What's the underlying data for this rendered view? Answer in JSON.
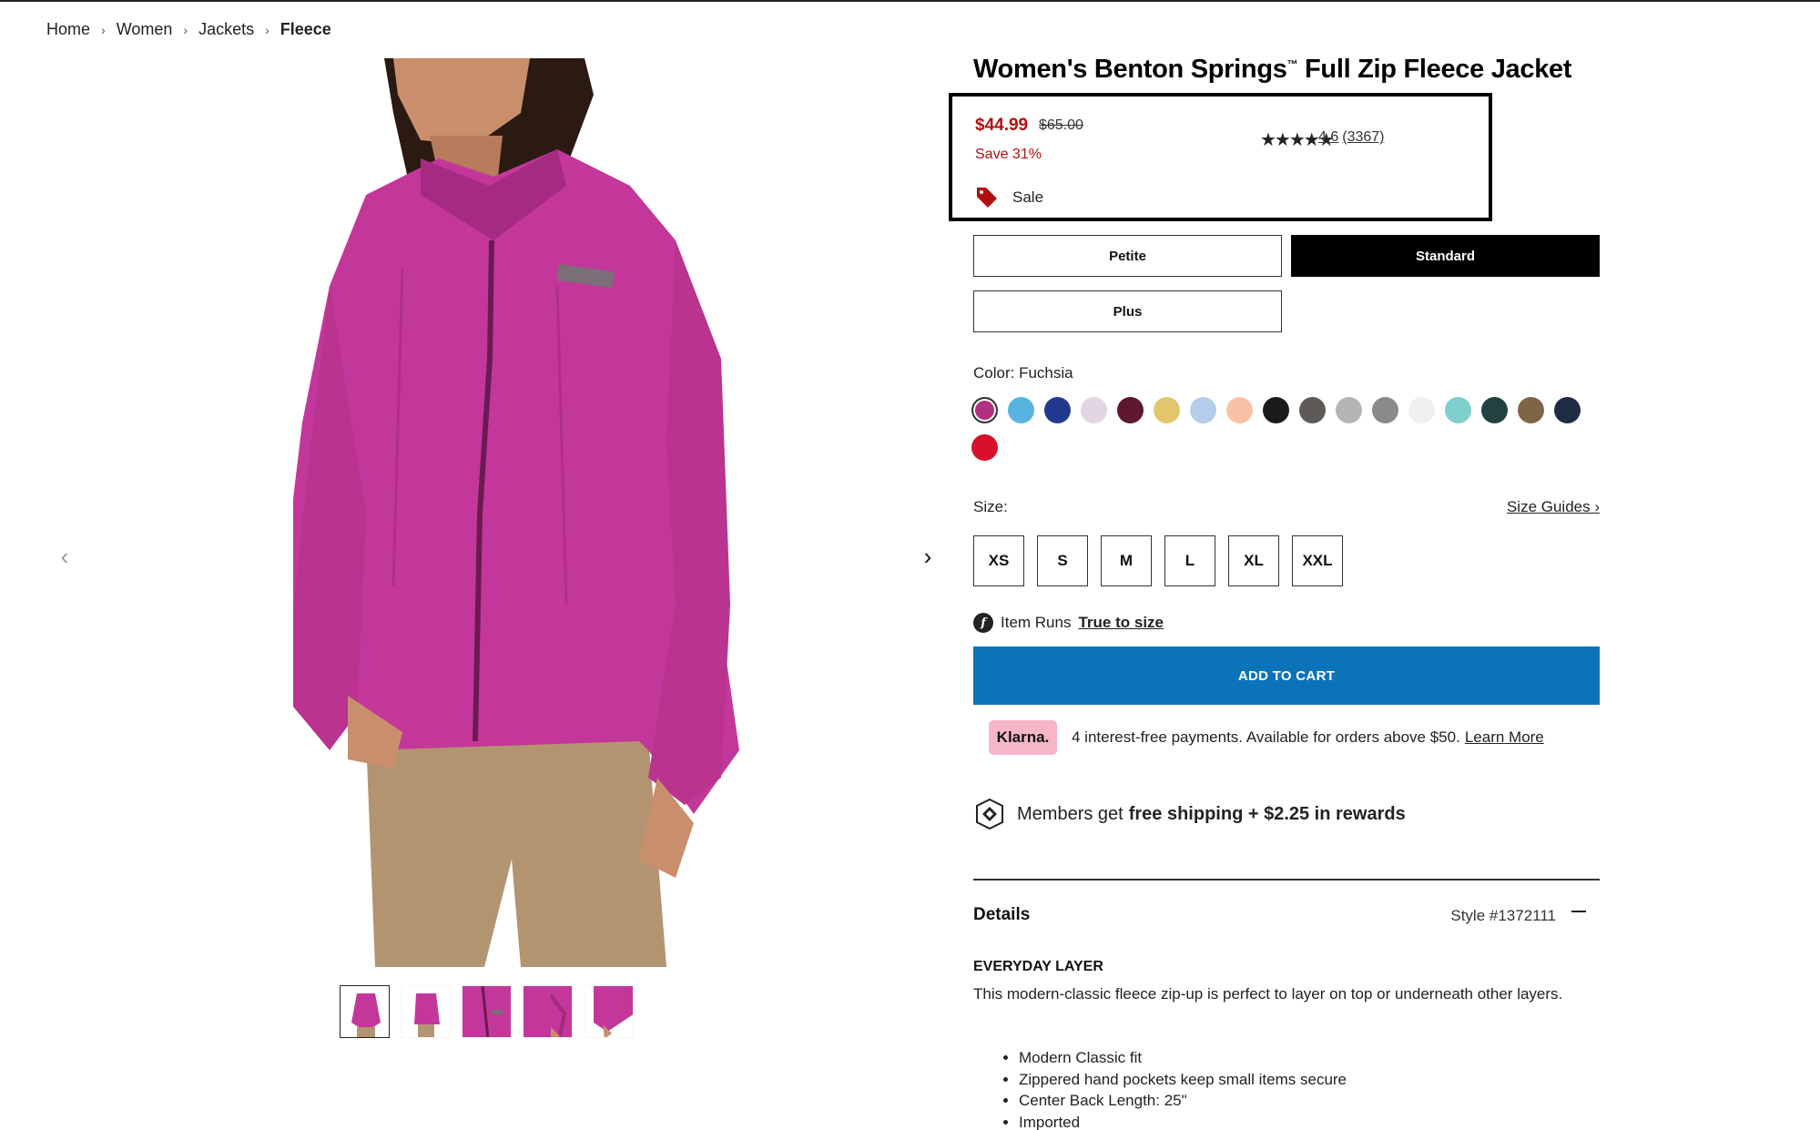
{
  "breadcrumb": {
    "items": [
      "Home",
      "Women",
      "Jackets"
    ],
    "current": "Fleece"
  },
  "product": {
    "title": "Women's Benton Springs",
    "title_mark": "™",
    "title_suffix": " Full Zip Fleece Jacket",
    "price_now": "$44.99",
    "price_was": "$65.00",
    "save": "Save 31%",
    "sale_label": "Sale",
    "stars": "★★★★★",
    "rating_value": "4.6",
    "rating_count": "(3367)"
  },
  "fits": [
    {
      "label": "Petite",
      "selected": false
    },
    {
      "label": "Standard",
      "selected": true
    },
    {
      "label": "Plus",
      "selected": false
    }
  ],
  "color": {
    "label": "Color: Fuchsia",
    "swatches": [
      "#b2307e",
      "#58b3e0",
      "#223a8e",
      "#e3d6e2",
      "#5e1631",
      "#e2c66a",
      "#b3cdeb",
      "#f9c2a7",
      "#1a1a1a",
      "#5d5a58",
      "#b5b5b5",
      "#8a8a8a",
      "#eef0ef",
      "#7fcfcc",
      "#21423f",
      "#7f6546",
      "#1f2c44",
      "#d8102a"
    ]
  },
  "size": {
    "label": "Size:",
    "guide": "Size Guides ›",
    "options": [
      "XS",
      "S",
      "M",
      "L",
      "XL",
      "XXL"
    ]
  },
  "fit_note": {
    "icon": "f",
    "prefix": "Item Runs",
    "link": "True to size"
  },
  "cart": {
    "label": "ADD TO CART"
  },
  "klarna": {
    "badge": "Klarna.",
    "text": "4 interest-free payments. Available for orders above $50.",
    "link": "Learn More"
  },
  "members": {
    "prefix": "Members get",
    "bold": "free shipping + $2.25 in rewards"
  },
  "details": {
    "heading": "Details",
    "style": "Style #1372111",
    "subheading": "EVERYDAY LAYER",
    "description": "This modern-classic fleece zip-up is perfect to layer on top or underneath other layers.",
    "bullets": [
      "Modern Classic fit",
      "Zippered hand pockets keep small items secure",
      "Center Back Length: 25\"",
      "Imported"
    ]
  },
  "gallery": {
    "prev": "‹",
    "next": "›",
    "thumb_count": 5
  },
  "colors": {
    "cart_blue": "#0b74b8",
    "sale_red": "#b01010",
    "klarna_pink": "#f7b6c8",
    "fleece": "#c4379a"
  }
}
